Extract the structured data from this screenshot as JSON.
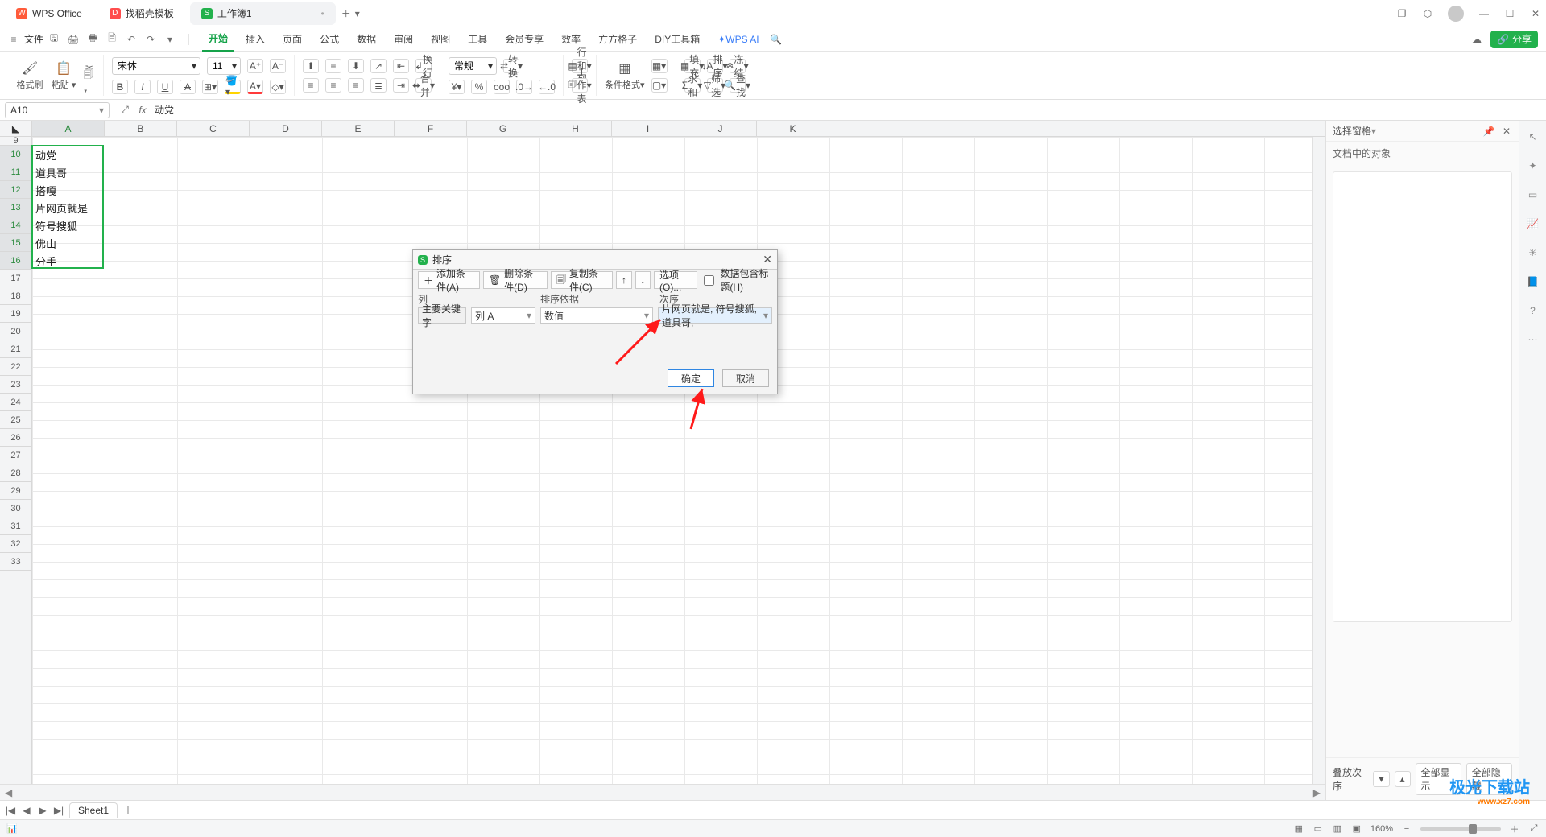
{
  "titlebar": {
    "tabs": [
      {
        "icon_color": "#ff5b3a",
        "icon_label": "W",
        "label": "WPS Office"
      },
      {
        "icon_color": "#ff4d4d",
        "icon_label": "D",
        "label": "找稻壳模板"
      },
      {
        "icon_color": "#22b14c",
        "icon_label": "S",
        "label": "工作簿1"
      }
    ]
  },
  "menubar": {
    "file": "文件",
    "tabs": [
      "开始",
      "插入",
      "页面",
      "公式",
      "数据",
      "审阅",
      "视图",
      "工具",
      "会员专享",
      "效率",
      "方方格子",
      "DIY工具箱"
    ],
    "ai": "WPS AI",
    "share": "分享"
  },
  "ribbon": {
    "format_brush": "格式刷",
    "paste": "粘贴",
    "font_name": "宋体",
    "font_size": "11",
    "bold": "B",
    "italic": "I",
    "underline": "U",
    "strike": "A",
    "wrap": "换行",
    "merge": "合并",
    "numfmt": "常规",
    "convert": "转换",
    "row_col": "行和列",
    "worksheet": "工作表",
    "cond_fmt": "条件格式",
    "fill": "填充",
    "sort": "排序",
    "freeze": "冻结",
    "sum": "求和",
    "filter": "筛选",
    "find": "查找"
  },
  "namebox": "A10",
  "formula": "动党",
  "columns": [
    "A",
    "B",
    "C",
    "D",
    "E",
    "F",
    "G",
    "H",
    "I",
    "J",
    "K"
  ],
  "row_start": 9,
  "row_end": 33,
  "data_rows": [
    {
      "r": 10,
      "v": "动党"
    },
    {
      "r": 11,
      "v": "道具哥"
    },
    {
      "r": 12,
      "v": "搭嘎"
    },
    {
      "r": 13,
      "v": "片网页就是"
    },
    {
      "r": 14,
      "v": "符号搜狐"
    },
    {
      "r": 15,
      "v": "佛山"
    },
    {
      "r": 16,
      "v": "分手"
    }
  ],
  "dialog": {
    "title": "排序",
    "add": "添加条件(A)",
    "del": "删除条件(D)",
    "copy": "复制条件(C)",
    "options": "选项(O)...",
    "header_chk": "数据包含标题(H)",
    "col_hdr": "列",
    "basis_hdr": "排序依据",
    "order_hdr": "次序",
    "key_label": "主要关键字",
    "key_value": "列 A",
    "basis_value": "数值",
    "order_value": "片网页就是, 符号搜狐, 道具哥,",
    "ok": "确定",
    "cancel": "取消"
  },
  "sheet_tab": "Sheet1",
  "panel": {
    "title": "选择窗格",
    "subtitle": "文档中的对象",
    "stack": "叠放次序",
    "show_all": "全部显示",
    "hide_all": "全部隐藏"
  },
  "statusbar": {
    "zoom": "160%"
  },
  "watermark": {
    "brand": "极光下载站",
    "url": "www.xz7.com"
  }
}
